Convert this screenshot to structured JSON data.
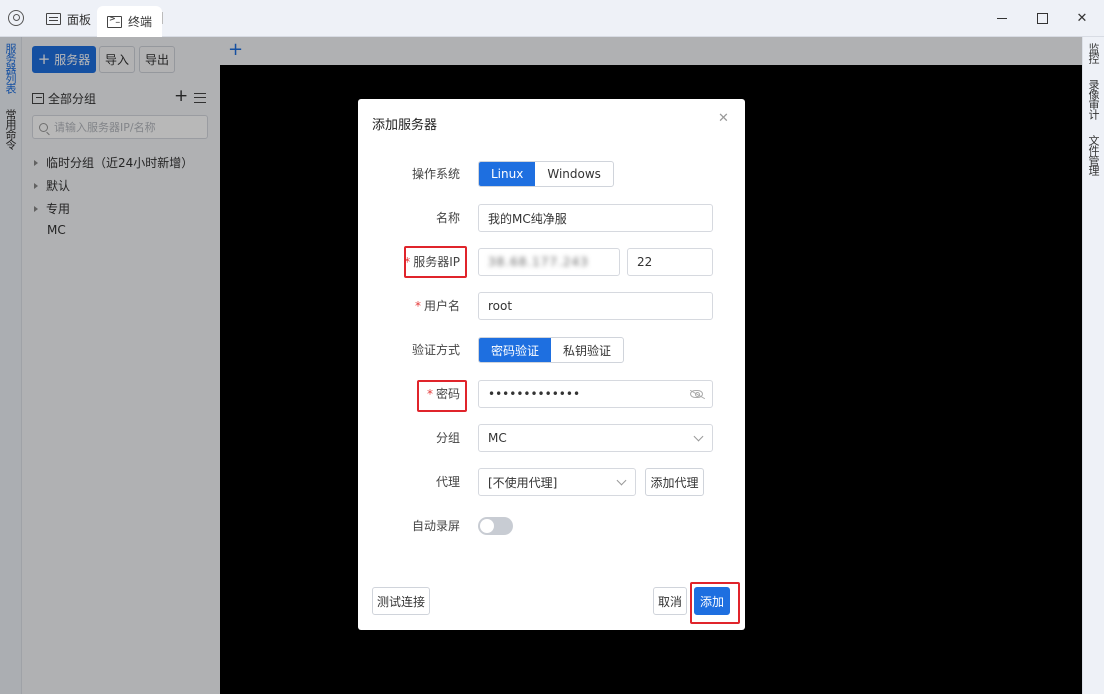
{
  "titlebar": {
    "tabs": [
      {
        "label": "面板",
        "icon": "panel-icon"
      },
      {
        "label": "终端",
        "icon": "terminal-icon"
      }
    ]
  },
  "leftnav": {
    "items": [
      "服务器列表",
      "常用命令"
    ]
  },
  "sidebar": {
    "add_server_label": "服务器",
    "import_label": "导入",
    "export_label": "导出",
    "all_groups_label": "全部分组",
    "search_placeholder": "请输入服务器IP/名称",
    "groups": [
      "临时分组（近24小时新增）",
      "默认",
      "专用"
    ],
    "servers": [
      "MC"
    ]
  },
  "rightnav": {
    "items": [
      "监控",
      "录像审计",
      "文件管理"
    ]
  },
  "dialog": {
    "title": "添加服务器",
    "os_label": "操作系统",
    "os_options": [
      "Linux",
      "Windows"
    ],
    "name_label": "名称",
    "name_value": "我的MC纯净服",
    "ip_label": "服务器IP",
    "ip_value": "38.68.177.243",
    "port_value": "22",
    "user_label": "用户名",
    "user_value": "root",
    "auth_label": "验证方式",
    "auth_options": [
      "密码验证",
      "私钥验证"
    ],
    "password_label": "密码",
    "password_value": "•••••••••••••",
    "group_label": "分组",
    "group_value": "MC",
    "proxy_label": "代理",
    "proxy_value": "[不使用代理]",
    "add_proxy_label": "添加代理",
    "auto_record_label": "自动录屏",
    "auto_record_on": false,
    "test_label": "测试连接",
    "cancel_label": "取消",
    "submit_label": "添加"
  },
  "colors": {
    "primary": "#1e6fe0",
    "highlight": "#e0242b",
    "required": "#e43a3a"
  }
}
